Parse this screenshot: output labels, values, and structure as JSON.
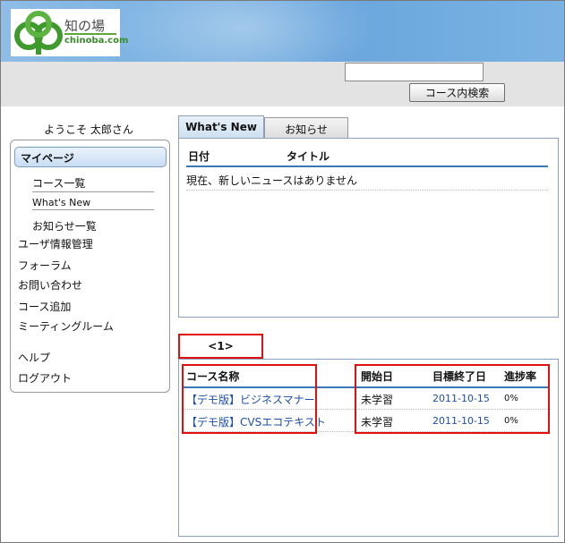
{
  "header": {
    "logo_jp": "知の場",
    "logo_en": "chinoba.com",
    "search_value": "",
    "search_button": "コース内検索"
  },
  "sidebar": {
    "welcome": "ようこそ 太郎さん",
    "mypage": "マイページ",
    "subitems": [
      "コース一覧",
      "What's New",
      "お知らせ一覧"
    ],
    "items": [
      "ユーザ情報管理",
      "フォーラム",
      "お問い合わせ",
      "コース追加",
      "ミーティングルーム",
      "ヘルプ",
      "ログアウト"
    ]
  },
  "news": {
    "tabs": [
      "What's New",
      "お知らせ"
    ],
    "col_date": "日付",
    "col_title": "タイトル",
    "empty": "現在、新しいニュースはありません"
  },
  "courses": {
    "page_tab": "<1>",
    "headers": {
      "name": "コース名称",
      "start": "開始日",
      "target_end": "目標終了日",
      "progress": "進捗率"
    },
    "rows": [
      {
        "name": "【デモ版】ビジネスマナー",
        "start": "未学習",
        "target_end": "2011-10-15",
        "progress": "0%"
      },
      {
        "name": "【デモ版】CVSエコテキスト",
        "start": "未学習",
        "target_end": "2011-10-15",
        "progress": "0%"
      }
    ]
  },
  "colors": {
    "highlight": "#e01010",
    "link": "#1e4fa8",
    "header_blue": "#79b1e2"
  }
}
